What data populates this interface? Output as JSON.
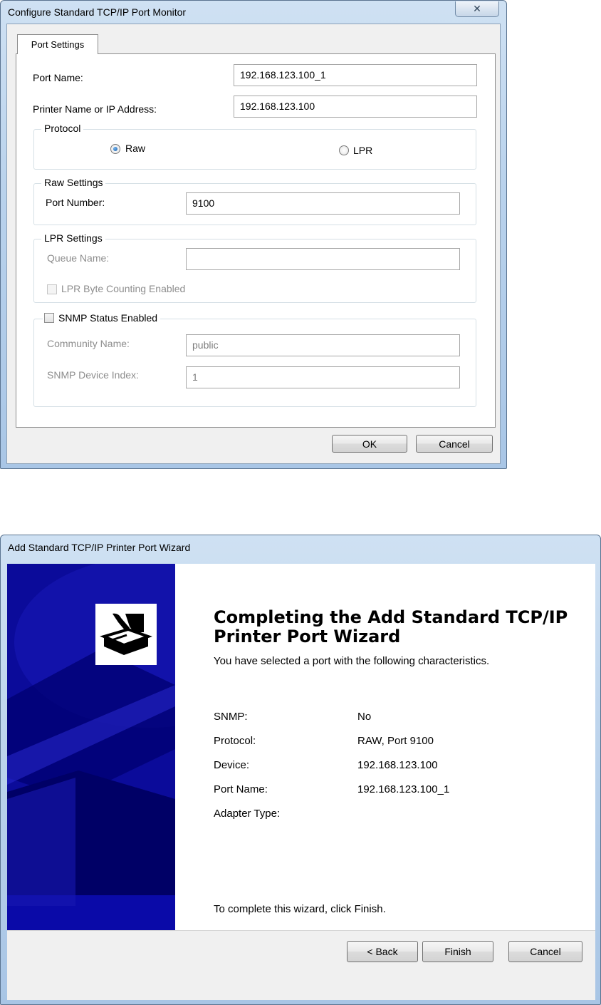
{
  "dialog1": {
    "title": "Configure Standard TCP/IP Port Monitor",
    "close_glyph": "✕",
    "tab_label": "Port Settings",
    "port_name_label": "Port Name:",
    "port_name_value": "192.168.123.100_1",
    "printer_label": "Printer Name or IP Address:",
    "printer_value": "192.168.123.100",
    "protocol": {
      "title": "Protocol",
      "raw_label": "Raw",
      "lpr_label": "LPR",
      "selected": "Raw"
    },
    "raw_settings": {
      "title": "Raw Settings",
      "port_number_label": "Port Number:",
      "port_number_value": "9100"
    },
    "lpr_settings": {
      "title": "LPR Settings",
      "queue_name_label": "Queue Name:",
      "queue_name_value": "",
      "byte_counting_label": "LPR Byte Counting Enabled"
    },
    "snmp": {
      "title": "SNMP Status Enabled",
      "community_label": "Community Name:",
      "community_value": "public",
      "device_index_label": "SNMP Device Index:",
      "device_index_value": "1"
    },
    "ok_label": "OK",
    "cancel_label": "Cancel"
  },
  "dialog2": {
    "title": "Add Standard TCP/IP Printer Port Wizard",
    "heading_line1": "Completing the Add Standard TCP/IP",
    "heading_line2": "Printer Port Wizard",
    "intro": "You have selected a port with the following characteristics.",
    "rows": [
      {
        "label": "SNMP:",
        "value": "No"
      },
      {
        "label": "Protocol:",
        "value": "RAW, Port 9100"
      },
      {
        "label": "Device:",
        "value": "192.168.123.100"
      },
      {
        "label": "Port Name:",
        "value": "192.168.123.100_1"
      },
      {
        "label": "Adapter Type:",
        "value": ""
      }
    ],
    "finish_text": "To complete this wizard, click Finish.",
    "back_label": "< Back",
    "finish_label": "Finish",
    "cancel_label": "Cancel"
  },
  "colors": {
    "banner_blue": "#0b0b9a",
    "banner_dark": "#000066",
    "frame_blue": "#b9d2ec"
  }
}
